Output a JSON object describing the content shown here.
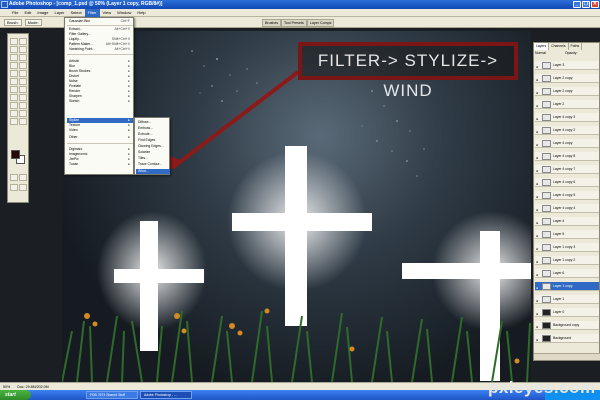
{
  "window": {
    "title": "Adobe Photoshop - [comp_1.psd @ 50% (Layer 1 copy, RGB/8#)]",
    "controls": [
      "_",
      "❐",
      "✕"
    ]
  },
  "menu_bar": [
    "File",
    "Edit",
    "Image",
    "Layer",
    "Select",
    "Filter",
    "View",
    "Window",
    "Help"
  ],
  "options_bar": {
    "brush_label": "Brush:",
    "mode_label": "Mode:",
    "palette_tabs": [
      "Brushes",
      "Tool Presets",
      "Layer Comps"
    ]
  },
  "filter_menu": {
    "items": [
      {
        "label": "Gaussian Blur",
        "shortcut": "Ctrl+F"
      },
      {
        "sep": true
      },
      {
        "label": "Extract...",
        "shortcut": "Alt+Ctrl+X"
      },
      {
        "label": "Filter Gallery..."
      },
      {
        "label": "Liquify...",
        "shortcut": "Shift+Ctrl+X"
      },
      {
        "label": "Pattern Maker...",
        "shortcut": "Alt+Shift+Ctrl+X"
      },
      {
        "label": "Vanishing Point...",
        "shortcut": "Alt+Ctrl+V"
      },
      {
        "sep": true
      },
      {
        "label": "Artistic",
        "arrow": "▸"
      },
      {
        "label": "Blur",
        "arrow": "▸"
      },
      {
        "label": "Brush Strokes",
        "arrow": "▸"
      },
      {
        "label": "Distort",
        "arrow": "▸"
      },
      {
        "label": "Noise",
        "arrow": "▸"
      },
      {
        "label": "Pixelate",
        "arrow": "▸"
      },
      {
        "label": "Render",
        "arrow": "▸"
      },
      {
        "label": "Sharpen",
        "arrow": "▸"
      },
      {
        "label": "Sketch",
        "arrow": "▸"
      },
      {
        "label": "Stylize",
        "arrow": "▸",
        "highlight": true
      },
      {
        "label": "Texture",
        "arrow": "▸"
      },
      {
        "label": "Video",
        "arrow": "▸"
      },
      {
        "label": "Other",
        "arrow": "▸"
      },
      {
        "sep": true
      },
      {
        "label": "Digimarc",
        "arrow": "▸"
      },
      {
        "label": "Imagenomic",
        "arrow": "▸"
      },
      {
        "label": "JixiPix",
        "arrow": "▸"
      },
      {
        "label": "Tucan",
        "arrow": "▸"
      }
    ]
  },
  "stylize_menu": {
    "items": [
      {
        "label": "Diffuse..."
      },
      {
        "label": "Emboss..."
      },
      {
        "label": "Extrude..."
      },
      {
        "label": "Find Edges"
      },
      {
        "label": "Glowing Edges..."
      },
      {
        "label": "Solarize"
      },
      {
        "label": "Tiles..."
      },
      {
        "label": "Trace Contour..."
      },
      {
        "label": "Wind...",
        "highlight": true
      }
    ]
  },
  "annotation": {
    "text": "FILTER-> STYLIZE-> WIND"
  },
  "layers_panel": {
    "tabs": [
      "Layers",
      "Channels",
      "Paths"
    ],
    "blend_mode": "Normal",
    "opacity_label": "Opacity:",
    "layers": [
      {
        "name": "Layer 3"
      },
      {
        "name": "Layer 2 copy"
      },
      {
        "name": "Layer 2 copy"
      },
      {
        "name": "Layer 2"
      },
      {
        "name": "Layer 4 copy 3"
      },
      {
        "name": "Layer 4 copy 2"
      },
      {
        "name": "Layer 4 copy"
      },
      {
        "name": "Layer 4 copy 8"
      },
      {
        "name": "Layer 4 copy 7"
      },
      {
        "name": "Layer 4 copy 6"
      },
      {
        "name": "Layer 4 copy 5"
      },
      {
        "name": "Layer 4 copy 4"
      },
      {
        "name": "Layer 4"
      },
      {
        "name": "Layer 5"
      },
      {
        "name": "Layer 1 copy 3"
      },
      {
        "name": "Layer 1 copy 2"
      },
      {
        "name": "Layer 6"
      },
      {
        "name": "Layer 1 copy",
        "selected": true
      },
      {
        "name": "Layer 1"
      },
      {
        "name": "Layer 0"
      },
      {
        "name": "Background copy"
      },
      {
        "name": "Background"
      }
    ]
  },
  "status_bar": {
    "zoom": "50%",
    "doc": "Doc: 29.8M/202.0M"
  },
  "taskbar": {
    "start": "start",
    "tasks": [
      "FDB 7673 Shared Stuff",
      "Adobe Photoshop - ..."
    ]
  },
  "watermark": "pxleyes.com",
  "colors": {
    "accent": "#316ac5",
    "annotation_border": "#7a1616",
    "arrow": "#8b1a1a"
  }
}
